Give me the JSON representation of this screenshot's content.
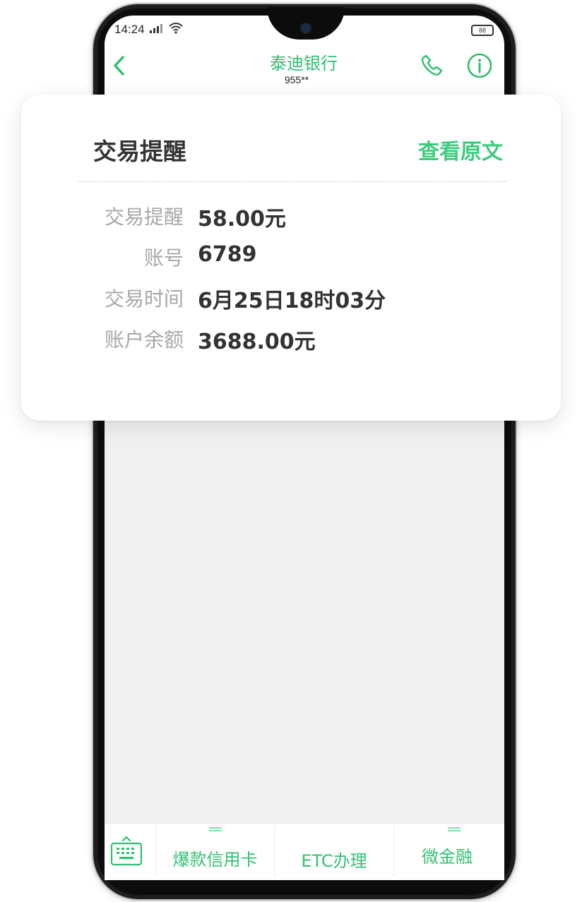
{
  "status_bar": {
    "time": "14:24",
    "battery": "88"
  },
  "header": {
    "sender_name": "泰迪银行",
    "sender_number": "955**"
  },
  "card": {
    "title": "交易提醒",
    "view_original_label": "查看原文",
    "fields": [
      {
        "label": "交易提醒",
        "value": "58.00元"
      },
      {
        "label": "账号",
        "value": "6789"
      },
      {
        "label": "交易时间",
        "value": "6月25日18时03分"
      },
      {
        "label": "账户余额",
        "value": "3688.00元"
      }
    ]
  },
  "bottom_menu": {
    "items": [
      {
        "label": "爆款信用卡"
      },
      {
        "label": "ETC办理"
      },
      {
        "label": "微金融"
      }
    ]
  },
  "colors": {
    "accent_green": "#2fbf6f",
    "screen_background": "#f0f0f0"
  },
  "icons": [
    "signal-icon",
    "wifi-icon",
    "battery-icon",
    "back-icon",
    "phone-icon",
    "info-icon",
    "keyboard-icon"
  ]
}
